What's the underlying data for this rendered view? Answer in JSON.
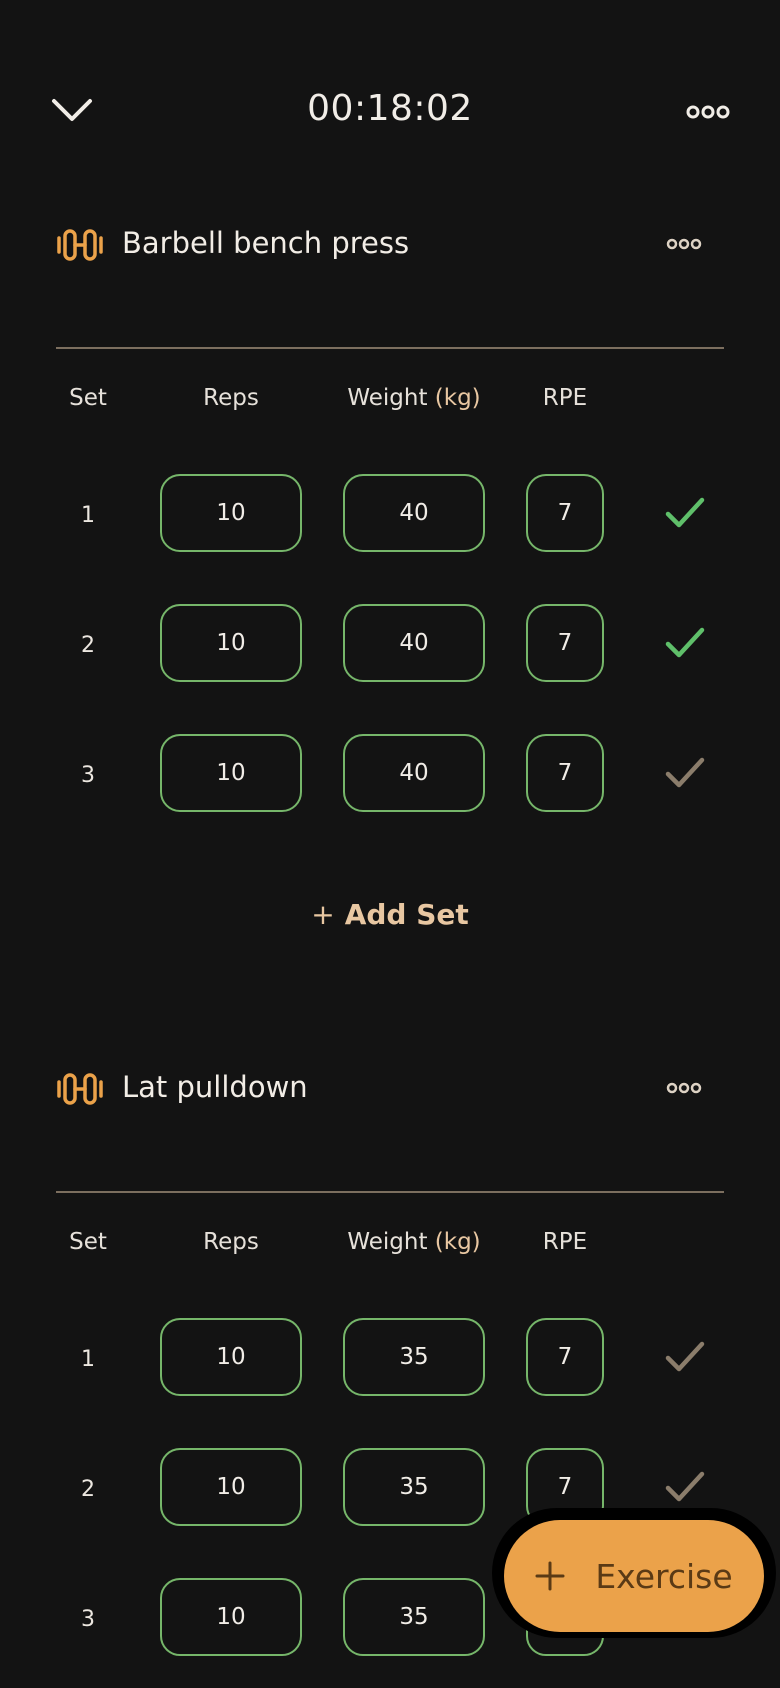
{
  "topbar": {
    "timer": "00:18:02",
    "collapse_icon": "chevron-down-icon",
    "menu_icon": "more-horizontal-icon"
  },
  "columns": {
    "set": "Set",
    "reps": "Reps",
    "weight": "Weight",
    "weight_unit": "(kg)",
    "rpe": "RPE"
  },
  "exercises": [
    {
      "name": "Barbell bench press",
      "icon": "dumbbell-icon",
      "sets": [
        {
          "set": "1",
          "reps": "10",
          "weight": "40",
          "rpe": "7",
          "completed": true
        },
        {
          "set": "2",
          "reps": "10",
          "weight": "40",
          "rpe": "7",
          "completed": true
        },
        {
          "set": "3",
          "reps": "10",
          "weight": "40",
          "rpe": "7",
          "completed": false
        }
      ],
      "add_set_label": "Add Set"
    },
    {
      "name": "Lat pulldown",
      "icon": "dumbbell-icon",
      "sets": [
        {
          "set": "1",
          "reps": "10",
          "weight": "35",
          "rpe": "7",
          "completed": false
        },
        {
          "set": "2",
          "reps": "10",
          "weight": "35",
          "rpe": "7",
          "completed": false
        },
        {
          "set": "3",
          "reps": "10",
          "weight": "35",
          "rpe": "",
          "completed": false
        }
      ]
    }
  ],
  "fab": {
    "label": "Exercise"
  },
  "colors": {
    "background": "#131313",
    "accent": "#eba24a",
    "input_border": "#76b66a",
    "check_done": "#5fbf6a",
    "check_pending": "#8b7d6b"
  }
}
